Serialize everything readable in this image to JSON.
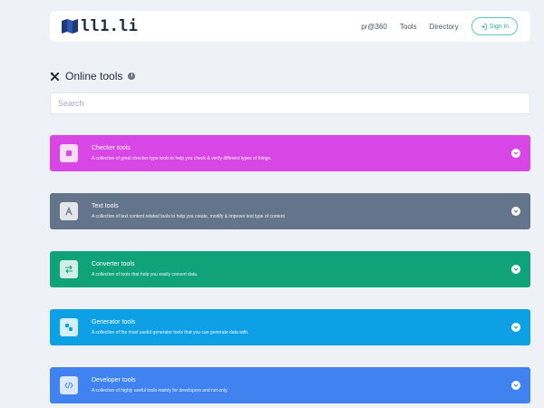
{
  "header": {
    "logo_text": "ll1.li",
    "logo_icon": "map-mark-icon",
    "nav": [
      {
        "label": "pr@360"
      },
      {
        "label": "Tools"
      },
      {
        "label": "Directory"
      }
    ],
    "signin_label": "Sign in",
    "signin_icon": "sign-in-icon",
    "accent_color": "#5ec7c1"
  },
  "page": {
    "title": "Online tools",
    "title_icon": "tools-icon",
    "info_icon": "info-icon"
  },
  "search": {
    "placeholder": "Search",
    "value": ""
  },
  "categories": [
    {
      "title": "Checker tools",
      "description": "A collection of great checker-type tools to help you check & verify different types of things.",
      "color": "#d846e6",
      "icon": "square-check-icon"
    },
    {
      "title": "Text tools",
      "description": "A collection of text content related tools to help you create, modify & improve text type of content.",
      "color": "#64748b",
      "icon": "letter-a-icon"
    },
    {
      "title": "Converter tools",
      "description": "A collection of tools that help you easily convert data.",
      "color": "#10a37a",
      "icon": "exchange-arrows-icon"
    },
    {
      "title": "Generator tools",
      "description": "A collection of the most useful generator tools that you can generate data with.",
      "color": "#0ea0e4",
      "icon": "generator-icon"
    },
    {
      "title": "Developer tools",
      "description": "A collection of highly useful tools mainly for developers and not only.",
      "color": "#3f82f0",
      "icon": "code-icon"
    }
  ]
}
